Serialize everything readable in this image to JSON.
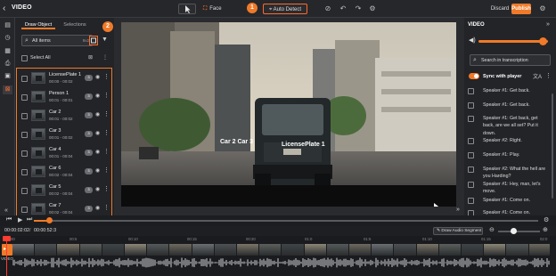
{
  "app": {
    "title": "VIDEO"
  },
  "toolbar": {
    "face_label": "Face",
    "auto_detect_label": "Auto Detect",
    "discard_label": "Discard",
    "publish_label": "Publish",
    "badge_1": "1",
    "accent_color": "#f07a28"
  },
  "left_panel": {
    "tabs": [
      {
        "label": "Draw Object"
      },
      {
        "label": "Selections"
      }
    ],
    "badge_2": "2",
    "search": {
      "value": "All items",
      "count": "9x2"
    },
    "select_all_label": "Select All",
    "items": [
      {
        "name": "LicensePlate 1",
        "time": "00:00 - 00:02",
        "badge": "3"
      },
      {
        "name": "Person 1",
        "time": "00:01 - 00:01",
        "badge": "3"
      },
      {
        "name": "Car 2",
        "time": "00:01 - 00:02",
        "badge": "3"
      },
      {
        "name": "Car 3",
        "time": "00:01 - 00:02",
        "badge": "3"
      },
      {
        "name": "Car 4",
        "time": "00:01 - 00:04",
        "badge": "3"
      },
      {
        "name": "Car 6",
        "time": "00:02 - 00:04",
        "badge": "3"
      },
      {
        "name": "Car 5",
        "time": "00:02 - 00:04",
        "badge": "3"
      },
      {
        "name": "Car 7",
        "time": "00:02 - 00:04",
        "badge": "3"
      }
    ]
  },
  "player": {
    "overlay_labels": [
      {
        "text": "Car 2 Car 3"
      },
      {
        "text": "LicensePlate 1"
      }
    ]
  },
  "right_panel": {
    "title": "VIDEO",
    "volume": 0.92,
    "transcript_search_placeholder": "Search in transcription",
    "sync_label": "Sync with player",
    "sync_on": true,
    "transcript": [
      "Speaker #1: Get back.",
      "Speaker #1: Get back.",
      "Speaker #1: Get back, get back, are we all set? Put it down.",
      "Speaker #2: Right.",
      "Speaker #1: Play.",
      "Speaker #2: What the hell are you Harding?",
      "Speaker #1: Hey, man, let's move.",
      "Speaker #1: Come on.",
      "Speaker #1: Come on."
    ]
  },
  "transport": {
    "current_time": "00:00:02:02",
    "total_time": "00:00:52:3",
    "draw_audio_label": "Draw Audio Segment",
    "progress": 0.03
  },
  "timeline": {
    "track_label": "VIDEO",
    "ruler": [
      "00",
      "00:5",
      "00:10",
      "00:15",
      "00:20",
      "01:0",
      "01:5",
      "01:10",
      "01:15",
      "02:0"
    ]
  }
}
